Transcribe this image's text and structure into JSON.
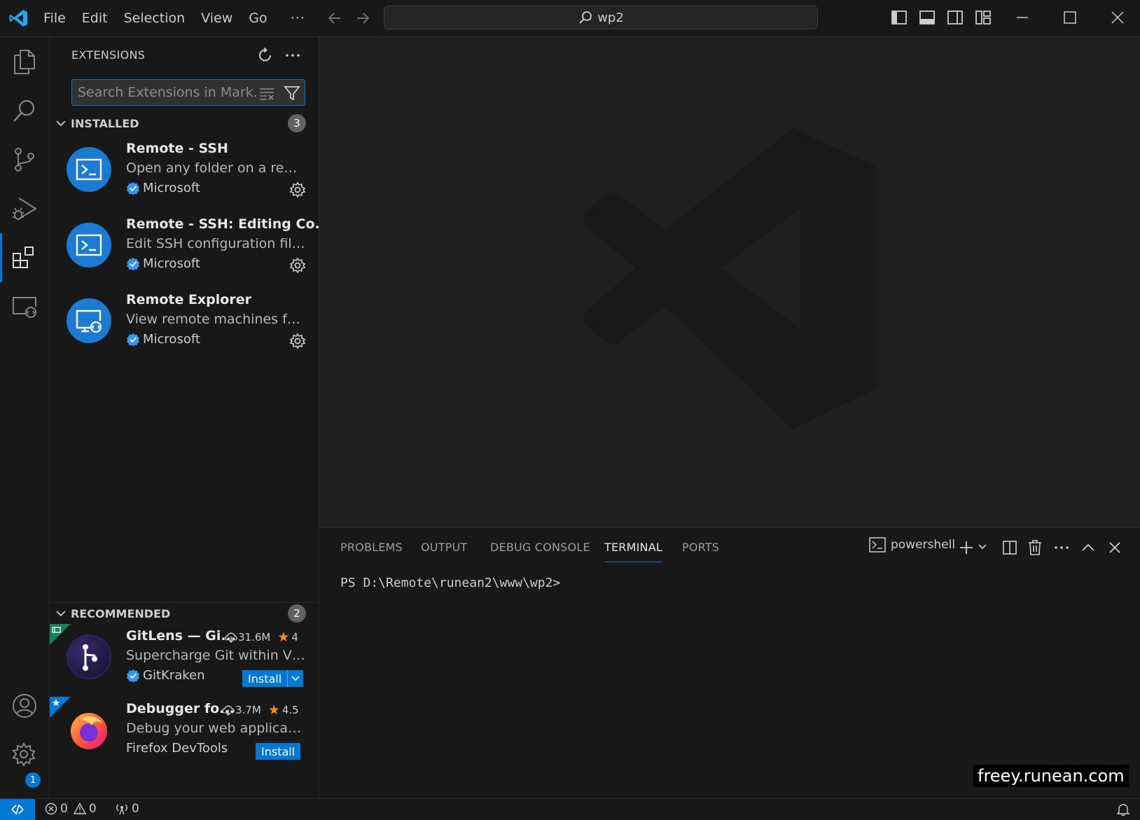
{
  "titlebar": {
    "menu": [
      "File",
      "Edit",
      "Selection",
      "View",
      "Go"
    ],
    "more": "···",
    "command_center": "wp2"
  },
  "sidebar": {
    "title": "EXTENSIONS",
    "search_placeholder": "Search Extensions in Mark...",
    "installed": {
      "label": "INSTALLED",
      "count": "3",
      "items": [
        {
          "name": "Remote - SSH",
          "description": "Open any folder on a remot...",
          "publisher": "Microsoft"
        },
        {
          "name": "Remote - SSH: Editing Co...",
          "description": "Edit SSH configuration files",
          "publisher": "Microsoft"
        },
        {
          "name": "Remote Explorer",
          "description": "View remote machines for S...",
          "publisher": "Microsoft"
        }
      ]
    },
    "recommended": {
      "label": "RECOMMENDED",
      "count": "2",
      "items": [
        {
          "name": "GitLens — Gi...",
          "downloads": "31.6M",
          "rating": "4",
          "description": "Supercharge Git within VS C...",
          "publisher": "GitKraken",
          "install": "Install"
        },
        {
          "name": "Debugger fo...",
          "downloads": "3.7M",
          "rating": "4.5",
          "description": "Debug your web application...",
          "publisher": "Firefox DevTools",
          "install": "Install"
        }
      ]
    }
  },
  "activitybar": {
    "settings_badge": "1"
  },
  "panel": {
    "tabs": [
      "PROBLEMS",
      "OUTPUT",
      "DEBUG CONSOLE",
      "TERMINAL",
      "PORTS"
    ],
    "active_tab": "TERMINAL",
    "terminal_name": "powershell",
    "prompt": "PS D:\\Remote\\runean2\\www\\wp2>"
  },
  "watermark": "freey.runean.com",
  "statusbar": {
    "errors": "0",
    "warnings": "0",
    "ports": "0"
  },
  "colors": {
    "accent": "#0078d4",
    "background": "#1f1f1f",
    "sidebar": "#181818",
    "star": "#ff8e00"
  }
}
